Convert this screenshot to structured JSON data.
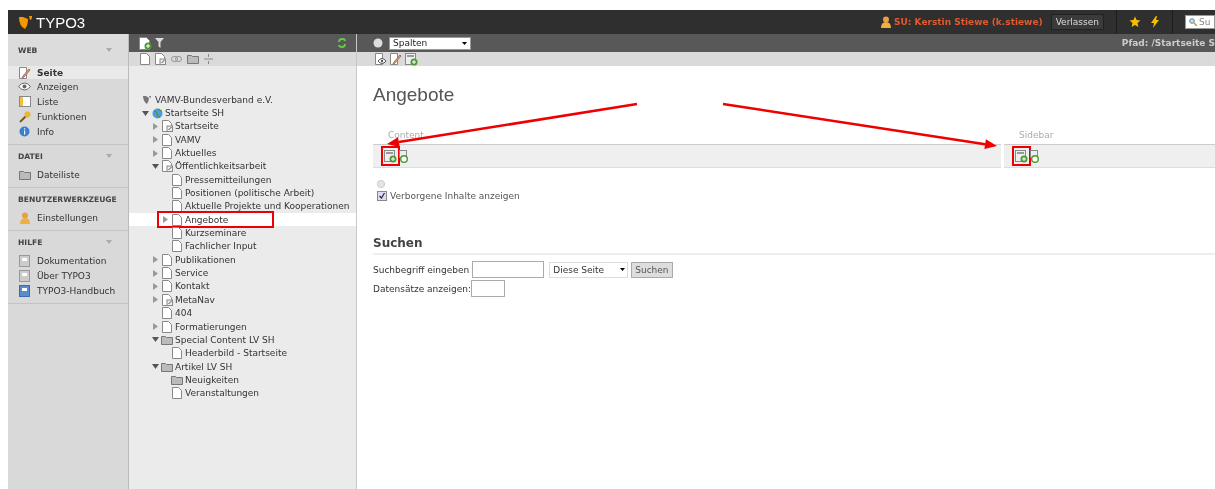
{
  "topbar": {
    "logo": "TYPO3",
    "user": "SU: Kerstin Stiewe (k.stiewe)",
    "exit_button": "Verlassen",
    "search": {
      "placeholder": "Su"
    }
  },
  "module_menu": [
    {
      "title": "WEB",
      "collapsible": true,
      "items": [
        {
          "label": "Seite",
          "kind": "page-edit",
          "selected": true
        },
        {
          "label": "Anzeigen",
          "kind": "eye",
          "selected": false
        },
        {
          "label": "Liste",
          "kind": "list",
          "selected": false
        },
        {
          "label": "Funktionen",
          "kind": "wrench",
          "selected": false
        },
        {
          "label": "Info",
          "kind": "info",
          "selected": false
        }
      ]
    },
    {
      "title": "DATEI",
      "collapsible": true,
      "items": [
        {
          "label": "Dateiliste",
          "kind": "folder",
          "selected": false
        }
      ]
    },
    {
      "title": "BENUTZERWERKZEUGE",
      "collapsible": false,
      "items": [
        {
          "label": "Einstellungen",
          "kind": "user",
          "selected": false
        }
      ]
    },
    {
      "title": "HILFE",
      "collapsible": true,
      "items": [
        {
          "label": "Dokumentation",
          "kind": "doc",
          "selected": false
        },
        {
          "label": "Über TYPO3",
          "kind": "doc",
          "selected": false
        },
        {
          "label": "TYPO3-Handbuch",
          "kind": "book",
          "selected": false
        }
      ]
    }
  ],
  "page_tree": [
    {
      "label": "VAMV-Bundesverband e.V.",
      "kind": "root",
      "expandable": false,
      "selected": false,
      "highlighted": false,
      "children": [
        {
          "label": "Startseite SH",
          "kind": "globe",
          "expandable": true,
          "expanded": true,
          "selected": false,
          "highlighted": false,
          "children": [
            {
              "label": "Startseite",
              "kind": "shortcut",
              "expandable": true,
              "expanded": false,
              "selected": false,
              "highlighted": false
            },
            {
              "label": "VAMV",
              "kind": "page",
              "expandable": true,
              "expanded": false,
              "selected": false,
              "highlighted": false
            },
            {
              "label": "Aktuelles",
              "kind": "page",
              "expandable": true,
              "expanded": false,
              "selected": false,
              "highlighted": false
            },
            {
              "label": "Öffentlichkeitsarbeit",
              "kind": "shortcut",
              "expandable": true,
              "expanded": true,
              "selected": false,
              "highlighted": false,
              "children": [
                {
                  "label": "Pressemitteilungen",
                  "kind": "page",
                  "expandable": false,
                  "selected": false,
                  "highlighted": false
                },
                {
                  "label": "Positionen (politische Arbeit)",
                  "kind": "page",
                  "expandable": false,
                  "selected": false,
                  "highlighted": false
                },
                {
                  "label": "Aktuelle Projekte und Kooperationen",
                  "kind": "page",
                  "expandable": false,
                  "selected": false,
                  "highlighted": false
                },
                {
                  "label": "Angebote",
                  "kind": "page",
                  "expandable": true,
                  "expanded": false,
                  "selected": true,
                  "highlighted": true
                },
                {
                  "label": "Kurzseminare",
                  "kind": "page",
                  "expandable": false,
                  "selected": false,
                  "highlighted": false
                },
                {
                  "label": "Fachlicher Input",
                  "kind": "page",
                  "expandable": false,
                  "selected": false,
                  "highlighted": false
                }
              ]
            },
            {
              "label": "Publikationen",
              "kind": "page",
              "expandable": true,
              "expanded": false,
              "selected": false,
              "highlighted": false
            },
            {
              "label": "Service",
              "kind": "page",
              "expandable": true,
              "expanded": false,
              "selected": false,
              "highlighted": false
            },
            {
              "label": "Kontakt",
              "kind": "page",
              "expandable": true,
              "expanded": false,
              "selected": false,
              "highlighted": false
            },
            {
              "label": "MetaNav",
              "kind": "shortcut",
              "expandable": true,
              "expanded": false,
              "selected": false,
              "highlighted": false
            },
            {
              "label": "404",
              "kind": "page",
              "expandable": false,
              "selected": false,
              "highlighted": false
            },
            {
              "label": "Formatierungen",
              "kind": "page",
              "expandable": true,
              "expanded": false,
              "selected": false,
              "highlighted": false
            },
            {
              "label": "Special Content LV SH",
              "kind": "folder",
              "expandable": true,
              "expanded": true,
              "selected": false,
              "highlighted": false,
              "children": [
                {
                  "label": "Headerbild - Startseite",
                  "kind": "page",
                  "expandable": false,
                  "selected": false,
                  "highlighted": false
                }
              ]
            },
            {
              "label": "Artikel LV SH",
              "kind": "folder",
              "expandable": true,
              "expanded": true,
              "selected": false,
              "highlighted": false,
              "children": [
                {
                  "label": "Neuigkeiten",
                  "kind": "folder",
                  "expandable": false,
                  "selected": false,
                  "highlighted": false
                },
                {
                  "label": "Veranstaltungen",
                  "kind": "page",
                  "expandable": false,
                  "selected": false,
                  "highlighted": false
                }
              ]
            }
          ]
        }
      ]
    }
  ],
  "doc_header": {
    "view_select": "Spalten",
    "path": "Pfad: /Startseite S"
  },
  "page_title": "Angebote",
  "columns": [
    {
      "label": "Content",
      "highlighted": true
    },
    {
      "label": "Sidebar",
      "highlighted": true
    }
  ],
  "hidden_toggle": {
    "label": "Verborgene Inhalte anzeigen",
    "checked": true
  },
  "search": {
    "heading": "Suchen",
    "term_label": "Suchbegriff eingeben",
    "scope": "Diese Seite",
    "button": "Suchen",
    "records_label": "Datensätze anzeigen:"
  }
}
